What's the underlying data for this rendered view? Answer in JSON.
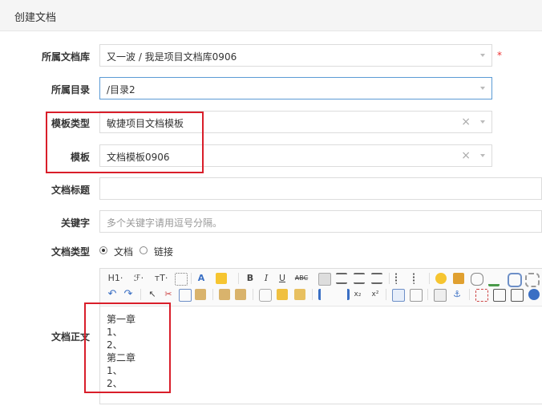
{
  "header": {
    "title": "创建文档"
  },
  "form": {
    "library": {
      "label": "所属文档库",
      "value": "又一波 / 我是项目文档库0906",
      "required": "*"
    },
    "directory": {
      "label": "所属目录",
      "value": "/目录2"
    },
    "template_type": {
      "label": "模板类型",
      "value": "敏捷项目文档模板",
      "clear": "×"
    },
    "template": {
      "label": "模板",
      "value": "文档模板0906",
      "clear": "×"
    },
    "title": {
      "label": "文档标题",
      "value": ""
    },
    "keywords": {
      "label": "关键字",
      "placeholder": "多个关键字请用逗号分隔。"
    },
    "doc_type": {
      "label": "文档类型",
      "options": [
        "文档",
        "链接"
      ],
      "selected": "文档"
    },
    "body": {
      "label": "文档正文",
      "lines": [
        "第一章",
        "1、",
        "2、",
        "第二章",
        "1、",
        "2、"
      ]
    }
  },
  "toolbar": {
    "heading": "H1·",
    "font_family": "ℱ·",
    "font_size": "ᴛT·",
    "bold": "B",
    "italic": "I",
    "underline": "U",
    "strike": "ABC",
    "subscript": "x₂",
    "superscript": "x²"
  },
  "colors": {
    "highlight_border": "#d91e2a",
    "active_border": "#5b9bd5",
    "required": "#e33333"
  }
}
